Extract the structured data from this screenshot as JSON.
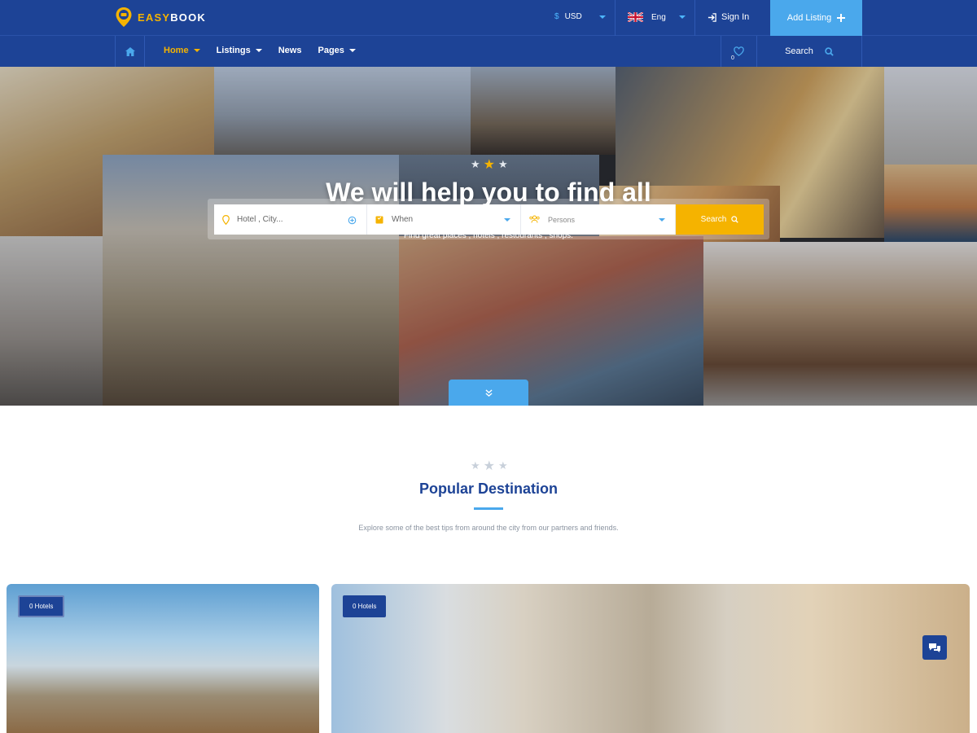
{
  "brand": {
    "logo_prefix": "EASY",
    "logo_suffix": "BOOK"
  },
  "topbar": {
    "currency_symbol": "$",
    "currency": "USD",
    "language": "Eng",
    "sign_in": "Sign In",
    "add_listing": "Add Listing"
  },
  "nav": {
    "items": [
      {
        "label": "Home",
        "active": true,
        "dropdown": true
      },
      {
        "label": "Listings",
        "active": false,
        "dropdown": true
      },
      {
        "label": "News",
        "active": false,
        "dropdown": false
      },
      {
        "label": "Pages",
        "active": false,
        "dropdown": true
      }
    ],
    "favorites_count": "0",
    "search_label": "Search"
  },
  "hero": {
    "title": "We will help you to find all",
    "subtitle": "Find great places , hotels , restourants , shops.",
    "search": {
      "location_placeholder": "Hotel , City...",
      "when_placeholder": "When",
      "persons_placeholder": "Persons",
      "button": "Search"
    }
  },
  "section": {
    "title": "Popular Destination",
    "subtitle": "Explore some of the best tips from around the city from our partners and friends."
  },
  "cards": [
    {
      "badge": "0 Hotels"
    },
    {
      "badge": "0 Hotels"
    }
  ],
  "colors": {
    "primary": "#1d4396",
    "accent_blue": "#4aa8ec",
    "accent_yellow": "#f5b300"
  }
}
